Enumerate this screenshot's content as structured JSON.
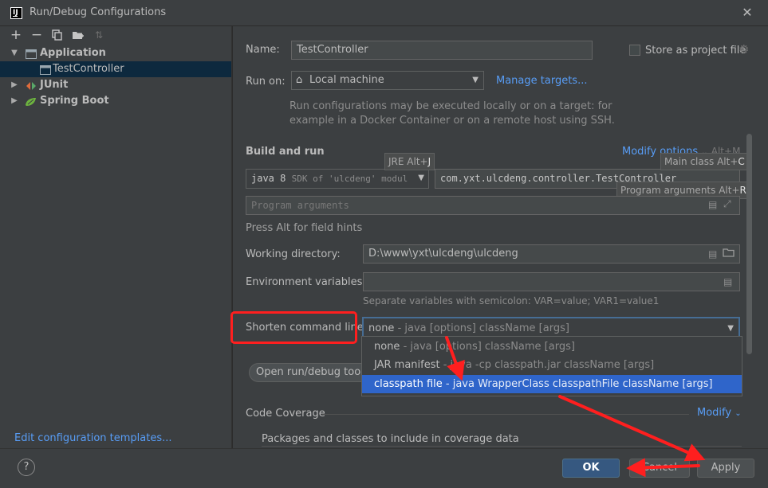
{
  "window": {
    "title": "Run/Debug Configurations"
  },
  "tree": {
    "application": "Application",
    "test_controller": "TestController",
    "junit": "JUnit",
    "spring_boot": "Spring Boot"
  },
  "edit_templates_link": "Edit configuration templates...",
  "form": {
    "name_label": "Name:",
    "name_value": "TestController",
    "store_label": "Store as project file",
    "run_on_label": "Run on:",
    "run_on_value": "Local machine",
    "manage_targets": "Manage targets...",
    "run_on_hint_1": "Run configurations may be executed locally or on a target: for",
    "run_on_hint_2": "example in a Docker Container or on a remote host using SSH.",
    "build_run_title": "Build and run",
    "modify_options": "Modify options",
    "modify_options_shortcut": "Alt+M",
    "jre_tooltip_text": "JRE Alt+",
    "jre_tooltip_key": "J",
    "main_class_tooltip_text": "Main class Alt+",
    "main_class_tooltip_key": "C",
    "prog_args_tooltip_text": "Program arguments Alt+",
    "prog_args_tooltip_key": "R",
    "jre_value_main": "java 8",
    "jre_value_dim": "SDK of 'ulcdeng' modul",
    "main_class_value": "com.yxt.ulcdeng.controller.TestController",
    "prog_args_placeholder": "Program arguments",
    "press_alt_hint": "Press Alt for field hints",
    "working_dir_label": "Working directory:",
    "working_dir_value": "D:\\www\\yxt\\ulcdeng\\ulcdeng",
    "env_vars_label": "Environment variables:",
    "env_vars_value": "",
    "env_vars_hint": "Separate variables with semicolon: VAR=value; VAR1=value1",
    "shorten_label": "Shorten command line:",
    "shorten_value_main": "none",
    "shorten_value_dim": "- java [options] className [args]",
    "open_tool_btn": "Open run/debug tool w",
    "code_coverage": "Code Coverage",
    "modify": "Modify",
    "packages_label": "Packages and classes to include in coverage data"
  },
  "dropdown_options": [
    {
      "main": "none",
      "dim": " - java [options] className [args]"
    },
    {
      "main": "JAR manifest",
      "dim": " - java -cp classpath.jar className [args]"
    },
    {
      "main": "classpath file",
      "dim": " - java WrapperClass classpathFile className [args]"
    }
  ],
  "buttons": {
    "help": "?",
    "ok": "OK",
    "cancel": "Cancel",
    "apply": "Apply"
  },
  "colors": {
    "accent": "#589df6",
    "selection": "#2f65ca",
    "annotation": "#ff1f1f",
    "primary_button": "#365880"
  },
  "icons": [
    "add-icon",
    "remove-icon",
    "copy-icon",
    "folder-add-icon",
    "sort-icon",
    "application-icon",
    "junit-icon",
    "spring-boot-icon",
    "gear-icon",
    "home-icon",
    "expand-icon",
    "folder-icon",
    "chevron-down-icon",
    "help-icon",
    "close-icon"
  ]
}
